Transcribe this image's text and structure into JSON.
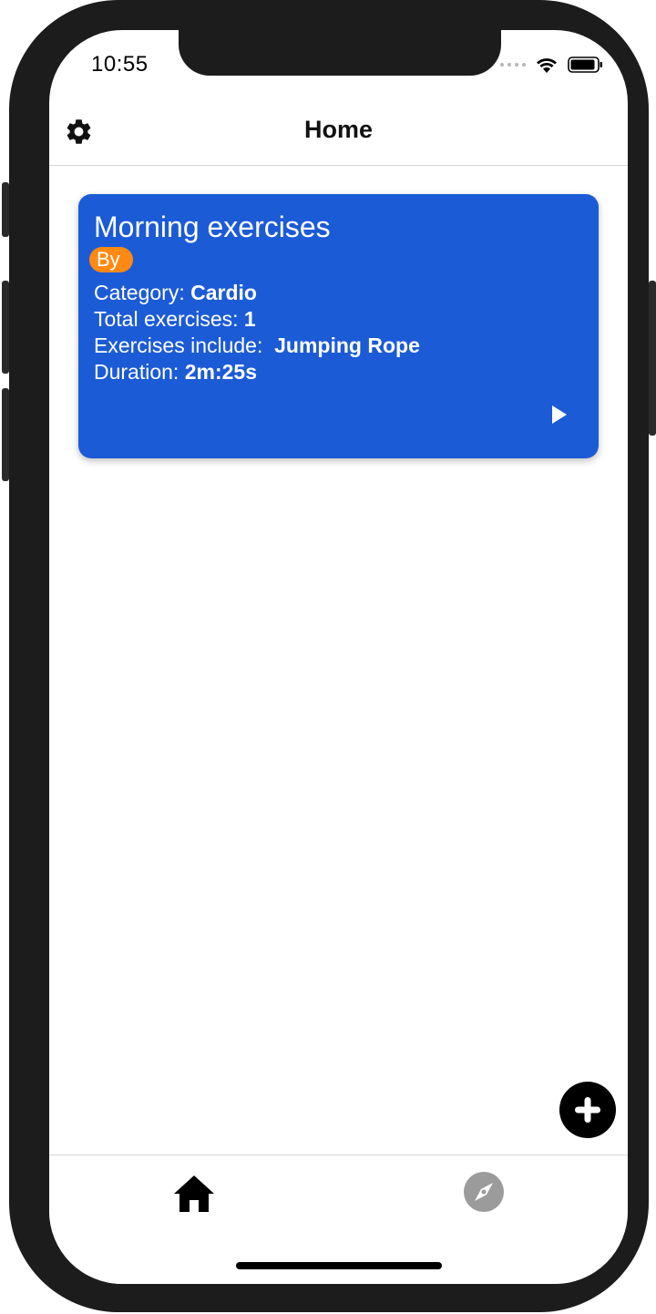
{
  "status_bar": {
    "time": "10:55"
  },
  "header": {
    "title": "Home",
    "settings_icon": "gear-icon"
  },
  "workout_card": {
    "title": "Morning exercises",
    "author_badge": "By",
    "category_label": "Category:",
    "category_value": "Cardio",
    "total_label": "Total exercises:",
    "total_value": "1",
    "includes_label": "Exercises include:",
    "includes_value": "Jumping Rope",
    "duration_label": "Duration:",
    "duration_value": "2m:25s",
    "play_icon": "play-icon"
  },
  "fab": {
    "icon": "plus-icon"
  },
  "tab_bar": {
    "tabs": [
      {
        "name": "home",
        "icon": "home-icon",
        "active": true
      },
      {
        "name": "explore",
        "icon": "compass-icon",
        "active": false
      }
    ]
  },
  "colors": {
    "card_background": "#1c5bd6",
    "author_badge": "#ff8a13",
    "active_tab": "#000000",
    "inactive_tab": "#9b9b9b"
  }
}
